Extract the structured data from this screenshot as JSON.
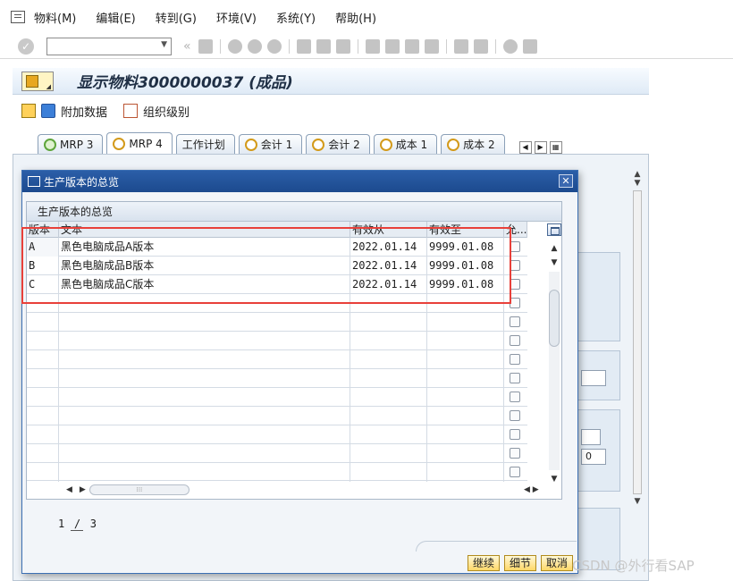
{
  "menu": {
    "items": [
      "物料(M)",
      "编辑(E)",
      "转到(G)",
      "环境(V)",
      "系统(Y)",
      "帮助(H)"
    ]
  },
  "toolbar": {
    "command_value": ""
  },
  "header": {
    "title": "显示物料3000000037 (成品)"
  },
  "app_toolbar": {
    "additional_data": "附加数据",
    "org_levels": "组织级别"
  },
  "tabs": [
    {
      "label": "MRP 3"
    },
    {
      "label": "MRP 4"
    },
    {
      "label": "工作计划"
    },
    {
      "label": "会计 1"
    },
    {
      "label": "会计 2"
    },
    {
      "label": "成本 1"
    },
    {
      "label": "成本 2"
    }
  ],
  "dialog": {
    "title": "生产版本的总览",
    "grid_caption": "生产版本的总览",
    "columns": {
      "version": "版本",
      "text": "文本",
      "valid_from": "有效从",
      "valid_to": "有效至",
      "flag": "允..."
    },
    "rows": [
      {
        "version": "A",
        "text": "黑色电脑成品A版本",
        "valid_from": "2022.01.14",
        "valid_to": "9999.01.08"
      },
      {
        "version": "B",
        "text": "黑色电脑成品B版本",
        "valid_from": "2022.01.14",
        "valid_to": "9999.01.08"
      },
      {
        "version": "C",
        "text": "黑色电脑成品C版本",
        "valid_from": "2022.01.14",
        "valid_to": "9999.01.08"
      }
    ],
    "pager": {
      "current": "1",
      "separator": "/",
      "total": "3"
    },
    "buttons": {
      "continue": "继续",
      "detail": "细节",
      "cancel": "取消"
    }
  },
  "background_fields": {
    "field_value": "0"
  },
  "watermark": "CSDN @外行看SAP"
}
